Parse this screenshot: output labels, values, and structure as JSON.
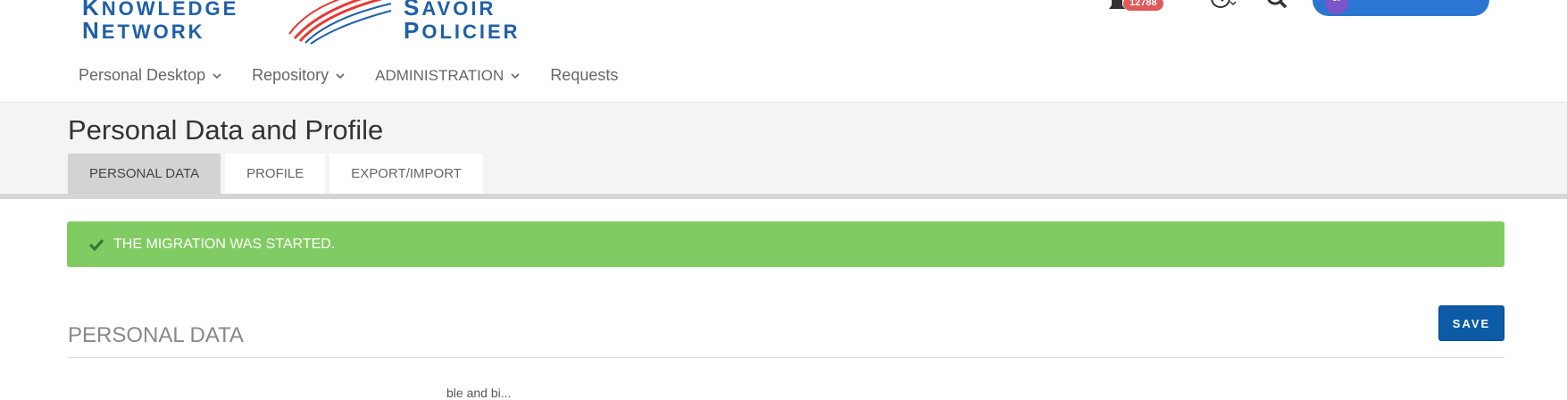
{
  "header": {
    "logo_left": {
      "line1_cap": "K",
      "line1_rest": "NOWLEDGE",
      "line2_cap": "N",
      "line2_rest": "ETWORK"
    },
    "logo_right": {
      "line1_cap": "S",
      "line1_rest": "AVOIR",
      "line2_cap": "P",
      "line2_rest": "OLICIER"
    },
    "notifications_count": "12788",
    "icons": {
      "notifications": "bell-icon",
      "history": "history-icon",
      "search": "search-icon",
      "avatar": "avatar"
    },
    "avatar_initials": "cr",
    "accent_color": "#2a76d2"
  },
  "nav": {
    "items": [
      {
        "label": "Personal Desktop",
        "has_dropdown": true
      },
      {
        "label": "Repository",
        "has_dropdown": true
      },
      {
        "label": "ADMINISTRATION",
        "has_dropdown": true
      },
      {
        "label": "Requests",
        "has_dropdown": false
      }
    ]
  },
  "page": {
    "title": "Personal Data and Profile",
    "tabs": [
      {
        "label": "PERSONAL DATA",
        "active": true
      },
      {
        "label": "PROFILE",
        "active": false
      },
      {
        "label": "EXPORT/IMPORT",
        "active": false
      }
    ]
  },
  "alert": {
    "text": "THE MIGRATION WAS STARTED.",
    "color": "#80cc62",
    "icon": "check-icon"
  },
  "section": {
    "title": "PERSONAL DATA",
    "save_label": "SAVE",
    "partial_text": "ble and bi..."
  }
}
